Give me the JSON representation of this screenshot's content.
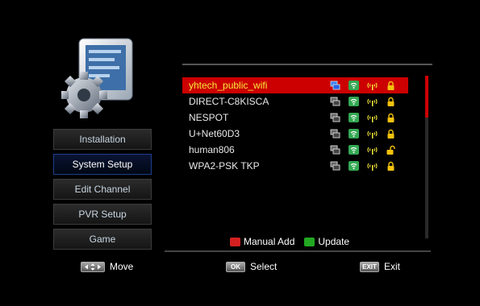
{
  "menu": {
    "items": [
      {
        "label": "Installation",
        "active": false
      },
      {
        "label": "System Setup",
        "active": true
      },
      {
        "label": "Edit Channel",
        "active": false
      },
      {
        "label": "PVR Setup",
        "active": false
      },
      {
        "label": "Game",
        "active": false
      }
    ]
  },
  "networks": [
    {
      "ssid": "yhtech_public_wifi",
      "selected": true,
      "locked": true
    },
    {
      "ssid": "DIRECT-C8KISCA",
      "selected": false,
      "locked": true
    },
    {
      "ssid": "NESPOT",
      "selected": false,
      "locked": true
    },
    {
      "ssid": "U+Net60D3",
      "selected": false,
      "locked": true
    },
    {
      "ssid": "human806",
      "selected": false,
      "locked": false
    },
    {
      "ssid": "WPA2-PSK TKP",
      "selected": false,
      "locked": true
    }
  ],
  "legend": {
    "manual_add": "Manual Add",
    "update": "Update"
  },
  "footer": {
    "move": "Move",
    "ok_key": "OK",
    "select": "Select",
    "exit_key": "EXIT",
    "exit": "Exit"
  },
  "colors": {
    "selection": "#cc0000",
    "selected_text": "#f8ec3c",
    "red_key": "#d42020",
    "green_key": "#22a822"
  }
}
